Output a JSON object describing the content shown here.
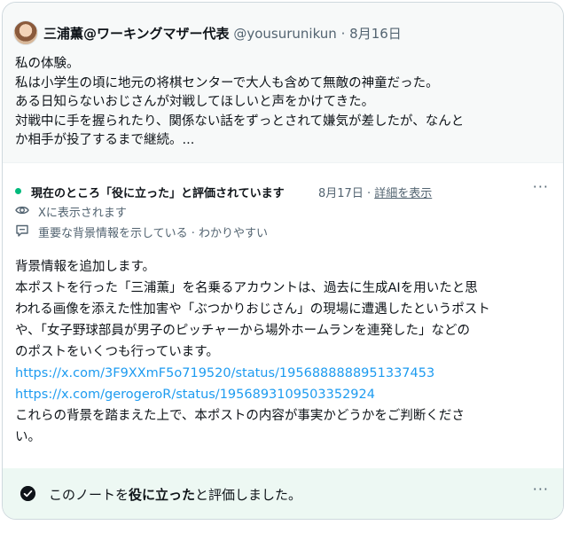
{
  "post": {
    "author_name": "三浦薫@ワーキングマザー代表",
    "handle": "@yousurunikun",
    "separator": "·",
    "date": "8月16日",
    "lines": [
      "私の体験。",
      "私は小学生の頃に地元の将棋センターで大人も含めて無敵の神童だった。",
      "ある日知らないおじさんが対戦してほしいと声をかけてきた。",
      "対戦中に手を握られたり、関係ない話をずっとされて嫌気が差したが、なんと",
      "か相手が投了するまで継続。..."
    ]
  },
  "note": {
    "status": "現在のところ「役に立った」と評価されています",
    "date": "8月17日",
    "separator": "·",
    "show_rating": "詳細を表示",
    "more": "···",
    "visibility": "Xに表示されます",
    "tags": "重要な背景情報を示している · わかりやすい",
    "lines_before_links": [
      "背景情報を追加します。",
      "本ポストを行った「三浦薫」を名乗るアカウントは、過去に生成AIを用いたと思",
      "われる画像を添えた性加害や「ぶつかりおじさん」の現場に遭遇したというポスト",
      "や、「女子野球部員が男子のピッチャーから場外ホームランを連発した」などの",
      "のポストをいくつも行っています。"
    ],
    "links": [
      "https://x.com/3F9XXmF5o719520/status/1956888888951337453",
      "https://x.com/gerogeroR/status/1956893109503352924"
    ],
    "lines_after_links": [
      "これらの背景を踏まえた上で、本ポストの内容が事実かどうかをご判断くださ",
      "い。"
    ]
  },
  "rating": {
    "text_before": "このノートを",
    "text_bold": "役に立った",
    "text_after": "と評価しました。",
    "more": "···"
  },
  "colors": {
    "accent_link": "#1d9bf0",
    "helpful_green": "#00ba7c",
    "rated_bg": "#edf8f3",
    "post_bg": "#f7f9f9"
  },
  "icons": [
    "green-status-dot",
    "eye-icon",
    "comment-icon",
    "check-circle-icon",
    "more-icon"
  ]
}
